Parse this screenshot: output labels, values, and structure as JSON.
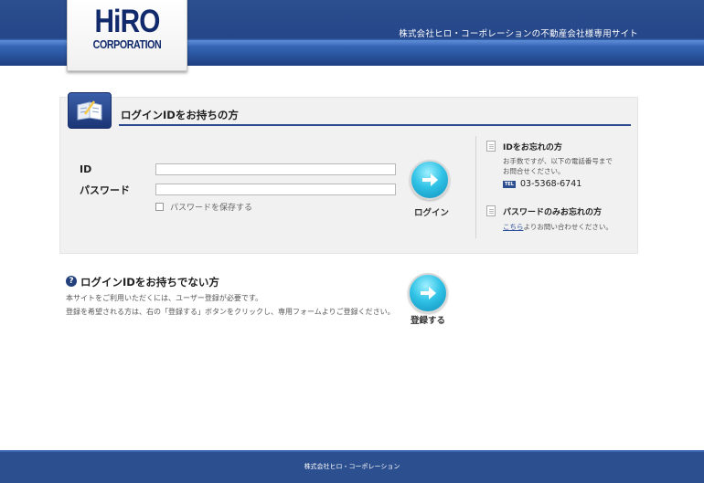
{
  "header": {
    "logo_main": "HiRO",
    "logo_sub": "CORPORATION",
    "site_tag": "株式会社ヒロ・コーポレーションの不動産会社様専用サイト"
  },
  "login": {
    "title": "ログインIDをお持ちの方",
    "id_label": "ID",
    "id_value": "",
    "password_label": "パスワード",
    "password_value": "",
    "remember_label": "パスワードを保存する",
    "login_button": "ログイン"
  },
  "side": {
    "forgot_id_title": "IDをお忘れの方",
    "forgot_id_text_1": "お手数ですが、以下の電話番号まで",
    "forgot_id_text_2": "お問合せください。",
    "tel_badge": "TEL",
    "tel_number": "03-5368-6741",
    "forgot_pw_title": "パスワードのみお忘れの方",
    "forgot_pw_link": "こちら",
    "forgot_pw_text": "よりお問い合わせください。"
  },
  "register": {
    "title": "ログインIDをお持ちでない方",
    "text_1": "本サイトをご利用いただくには、ユーザー登録が必要です。",
    "text_2": "登録を希望される方は、右の「登録する」ボタンをクリックし、専用フォームよりご登録ください。",
    "button": "登録する"
  },
  "footer": {
    "text": "株式会社ヒロ・コーポレーション"
  },
  "colors": {
    "brand_navy": "#2b4f8f",
    "button_cyan": "#31c3e6"
  }
}
